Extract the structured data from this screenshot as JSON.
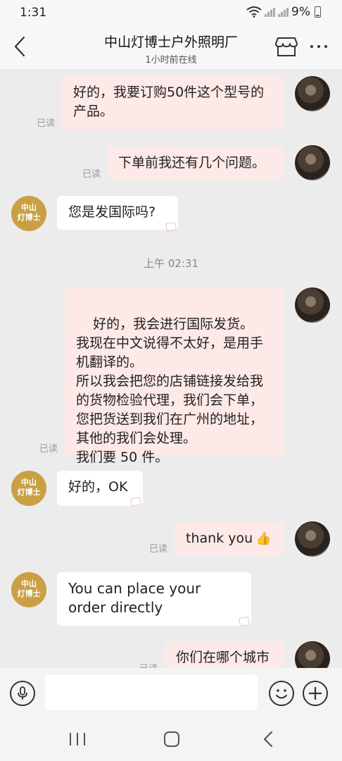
{
  "status_bar": {
    "time": "1:31",
    "battery": "9%"
  },
  "header": {
    "title": "中山灯博士户外照明厂",
    "subtitle": "1小时前在线"
  },
  "shop_avatar": {
    "line1": "中山",
    "line2": "灯博士"
  },
  "messages": [
    {
      "text": "好的，我要订购50件这个型号的产品。",
      "read": "已读"
    },
    {
      "text": "下单前我还有几个问题。",
      "read": "已读"
    },
    {
      "text": "您是发国际吗?"
    },
    {
      "text": "好的，我会进行国际发货。\n我现在中文说得不太好，是用手机翻译的。\n所以我会把您的店铺链接发给我的货物检验代理，我们会下单，您把货送到我们在广州的地址，其他的我们会处理。\n我们要 50 件。",
      "read": "已读"
    },
    {
      "text": "好的，OK"
    },
    {
      "text": "thank you",
      "read": "已读"
    },
    {
      "text": "You can place your order directly"
    },
    {
      "text": "你们在哪个城市",
      "read": "已读"
    }
  ],
  "timestamp": "上午 02:31",
  "input": {
    "placeholder": ""
  },
  "icons": [
    "back-icon",
    "store-icon",
    "more-icon",
    "mic-icon",
    "emoji-icon",
    "plus-icon",
    "thumbs-up-icon"
  ],
  "colors": {
    "outgoing_bubble": "#fde9e7",
    "incoming_bubble": "#ffffff",
    "shop_avatar": "#c9a043",
    "background": "#ececec"
  }
}
